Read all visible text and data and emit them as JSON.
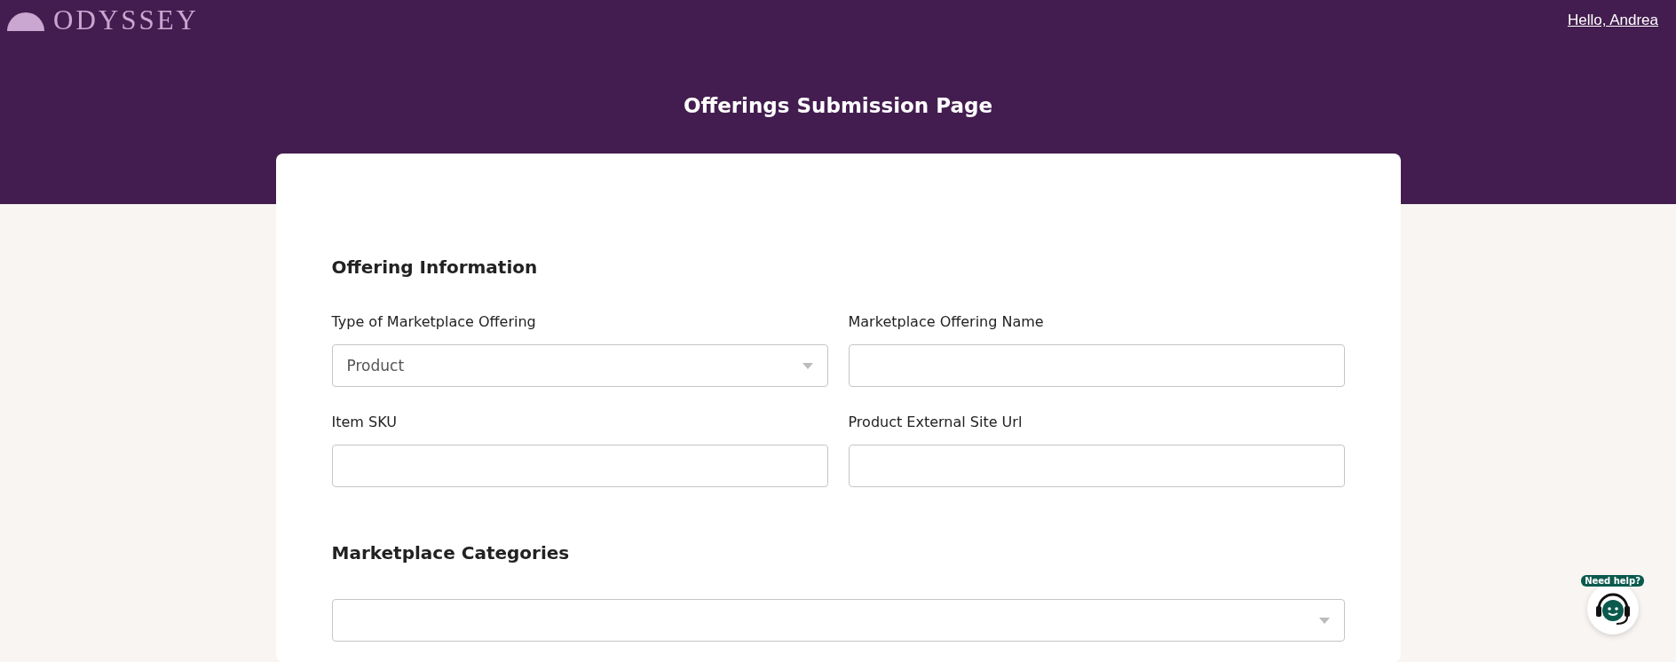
{
  "header": {
    "logo": "ODYSSEY",
    "greeting": "Hello, Andrea",
    "title": "Offerings Submission Page"
  },
  "sections": [
    {
      "heading": "Offering Information",
      "fields": [
        {
          "kind": "select",
          "label": "Type of Marketplace Offering",
          "value": "Product"
        },
        {
          "kind": "text",
          "label": "Marketplace Offering Name"
        },
        {
          "kind": "text",
          "label": "Item SKU"
        },
        {
          "kind": "text",
          "label": "Product External Site Url"
        }
      ]
    },
    {
      "heading": "Marketplace Categories",
      "fields": [
        {
          "kind": "select",
          "wide": true
        }
      ]
    }
  ],
  "help": {
    "label": "Need help?"
  }
}
